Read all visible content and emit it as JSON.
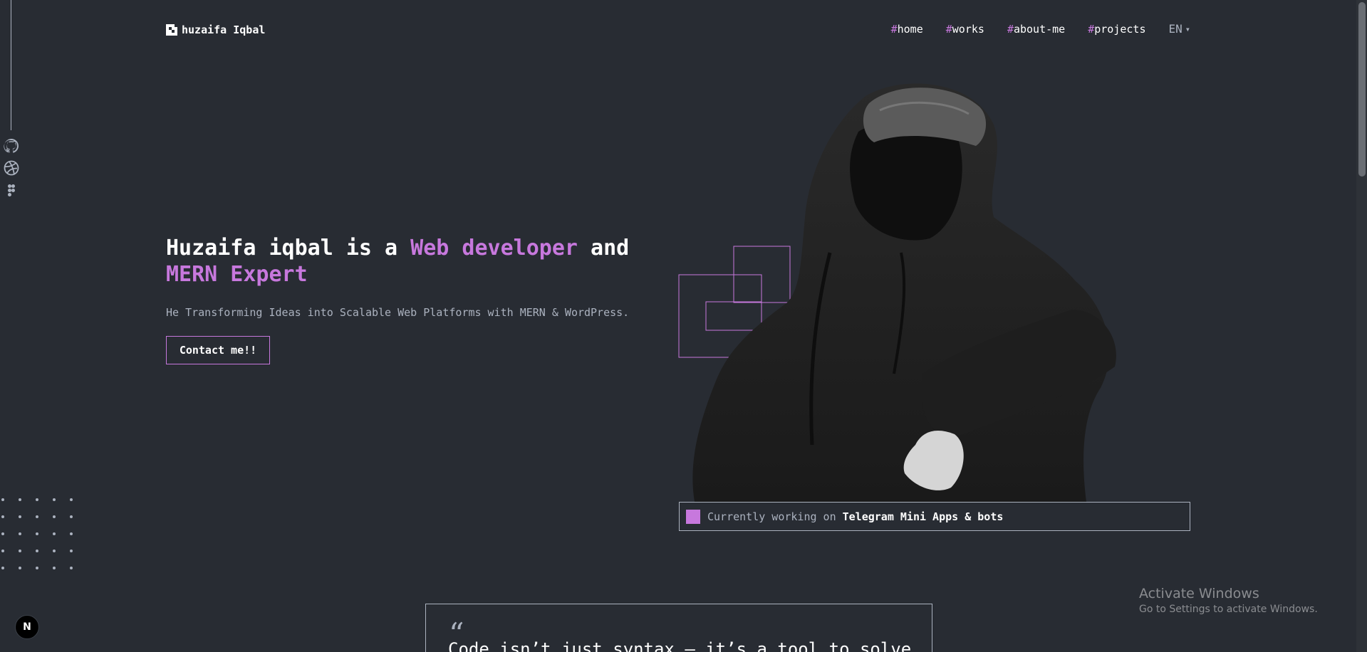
{
  "header": {
    "logo_text": "huzaifa Iqbal",
    "nav": [
      {
        "hash": "#",
        "label": "home"
      },
      {
        "hash": "#",
        "label": "works"
      },
      {
        "hash": "#",
        "label": "about-me"
      },
      {
        "hash": "#",
        "label": "projects"
      }
    ],
    "language": "EN"
  },
  "social": {
    "icons": [
      "github-icon",
      "dribbble-icon",
      "figma-icon"
    ]
  },
  "hero": {
    "title_part1": "Huzaifa iqbal is a ",
    "title_accent1": "Web developer",
    "title_part2": " and",
    "title_accent2": "MERN Expert",
    "subtitle": "He Transforming Ideas into Scalable Web Platforms with MERN & WordPress.",
    "cta_label": "Contact me!!"
  },
  "status": {
    "prefix": "Currently working on",
    "highlight": "Telegram Mini Apps & bots"
  },
  "quote": {
    "mark": "“",
    "text": "Code isn’t just syntax — it’s a tool to solve"
  },
  "windows_watermark": {
    "line1": "Activate Windows",
    "line2": "Go to Settings to activate Windows."
  },
  "badge": {
    "letter": "N"
  },
  "colors": {
    "background": "#282c33",
    "accent": "#c778dd",
    "muted": "#abb2bf",
    "text": "#ffffff"
  }
}
